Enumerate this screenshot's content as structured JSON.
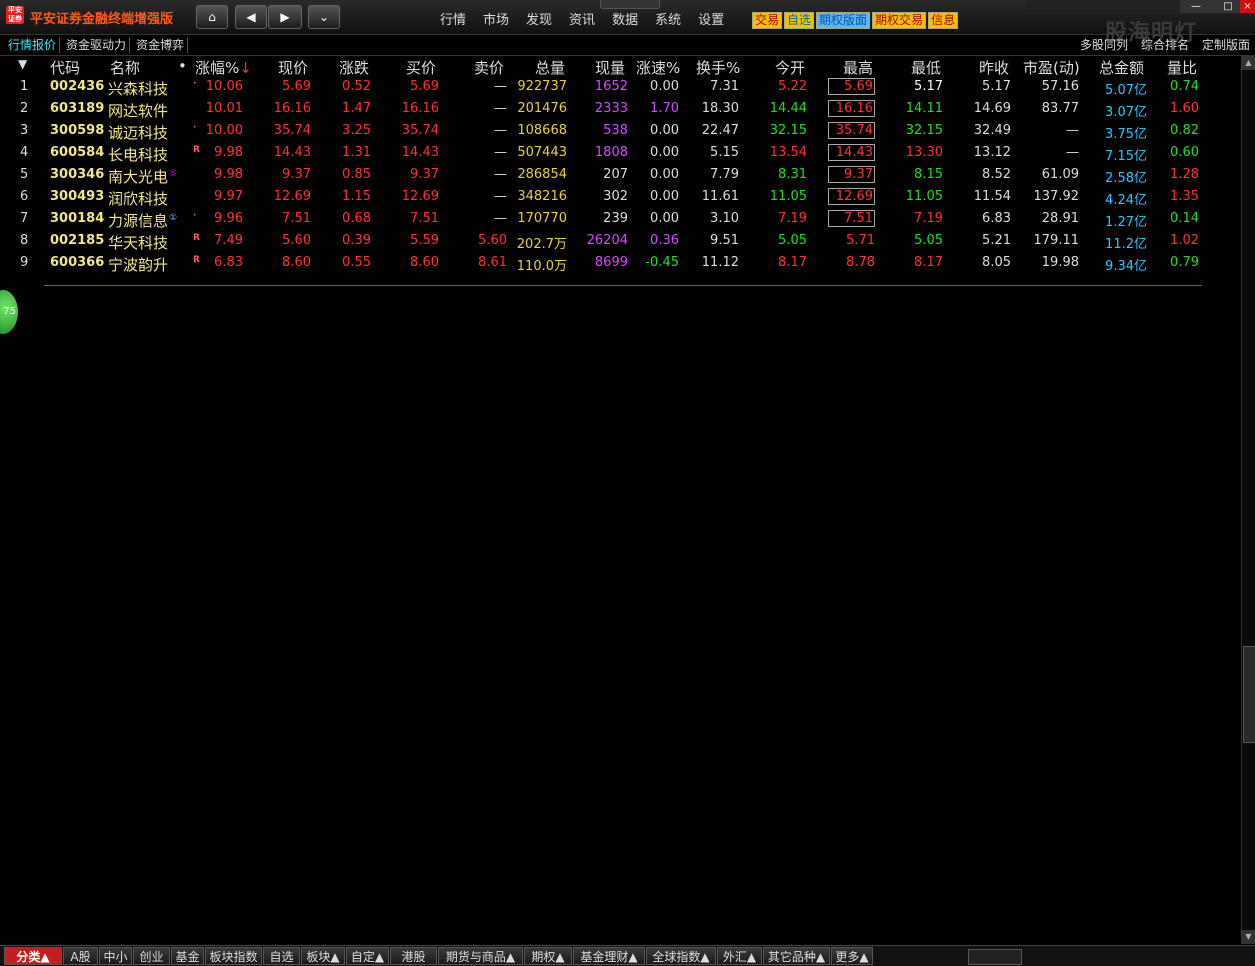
{
  "app": {
    "title": "平安证券金融终端增强版",
    "logo_text": "平安证券",
    "watermark": "股海明灯"
  },
  "nav": {
    "home_icon": "⌂",
    "back_icon": "◀",
    "fwd_icon": "▶",
    "menu_icon": "⌄"
  },
  "menu": [
    "行情",
    "市场",
    "发现",
    "资讯",
    "数据",
    "系统",
    "设置"
  ],
  "quick": {
    "trade": "交易",
    "watch": "自选",
    "option_board": "期权版面",
    "option_trade": "期权交易",
    "info": "信息"
  },
  "window": {
    "min": "—",
    "max": "□",
    "close": "×"
  },
  "tabs": [
    "行情报价",
    "资金驱动力",
    "资金博弈"
  ],
  "right_tabs": [
    "多股同列",
    "综合排名",
    "定制版面"
  ],
  "headers": {
    "idx": "▼",
    "code": "代码",
    "name": "名称",
    "dot": "•",
    "pct": "涨幅%",
    "sort": "↓",
    "price": "现价",
    "chg": "涨跌",
    "bid": "买价",
    "ask": "卖价",
    "vol": "总量",
    "cur": "现量",
    "speed": "涨速%",
    "turn": "换手%",
    "open": "今开",
    "high": "最高",
    "low": "最低",
    "prev": "昨收",
    "pe": "市盈(动)",
    "amt": "总金额",
    "vr": "量比"
  },
  "rows": [
    {
      "idx": "1",
      "code": "002436",
      "name": "兴森科技",
      "badge": "",
      "mark": "·",
      "pct": "10.06",
      "price": "5.69",
      "chg": "0.52",
      "bid": "5.69",
      "ask": "—",
      "vol": "922737",
      "cur": "1652",
      "speed": "0.00",
      "turn": "7.31",
      "open": "5.22",
      "high": "5.69",
      "low": "5.17",
      "prev": "5.17",
      "pe": "57.16",
      "amt": "5.07亿",
      "vr": "0.74"
    },
    {
      "idx": "2",
      "code": "603189",
      "name": "网达软件",
      "badge": "",
      "mark": "",
      "pct": "10.01",
      "price": "16.16",
      "chg": "1.47",
      "bid": "16.16",
      "ask": "—",
      "vol": "201476",
      "cur": "2333",
      "speed": "1.70",
      "turn": "18.30",
      "open": "14.44",
      "high": "16.16",
      "low": "14.11",
      "prev": "14.69",
      "pe": "83.77",
      "amt": "3.07亿",
      "vr": "1.60"
    },
    {
      "idx": "3",
      "code": "300598",
      "name": "诚迈科技",
      "badge": "",
      "mark": "·",
      "pct": "10.00",
      "price": "35.74",
      "chg": "3.25",
      "bid": "35.74",
      "ask": "—",
      "vol": "108668",
      "cur": "538",
      "speed": "0.00",
      "turn": "22.47",
      "open": "32.15",
      "high": "35.74",
      "low": "32.15",
      "prev": "32.49",
      "pe": "—",
      "amt": "3.75亿",
      "vr": "0.82"
    },
    {
      "idx": "4",
      "code": "600584",
      "name": "长电科技",
      "badge": "",
      "mark": "R",
      "pct": "9.98",
      "price": "14.43",
      "chg": "1.31",
      "bid": "14.43",
      "ask": "—",
      "vol": "507443",
      "cur": "1808",
      "speed": "0.00",
      "turn": "5.15",
      "open": "13.54",
      "high": "14.43",
      "low": "13.30",
      "prev": "13.12",
      "pe": "—",
      "amt": "7.15亿",
      "vr": "0.60"
    },
    {
      "idx": "5",
      "code": "300346",
      "name": "南大光电",
      "badge": "⑤",
      "mark": "",
      "pct": "9.98",
      "price": "9.37",
      "chg": "0.85",
      "bid": "9.37",
      "ask": "—",
      "vol": "286854",
      "cur": "207",
      "speed": "0.00",
      "turn": "7.79",
      "open": "8.31",
      "high": "9.37",
      "low": "8.15",
      "prev": "8.52",
      "pe": "61.09",
      "amt": "2.58亿",
      "vr": "1.28"
    },
    {
      "idx": "6",
      "code": "300493",
      "name": "润欣科技",
      "badge": "",
      "mark": "",
      "pct": "9.97",
      "price": "12.69",
      "chg": "1.15",
      "bid": "12.69",
      "ask": "—",
      "vol": "348216",
      "cur": "302",
      "speed": "0.00",
      "turn": "11.61",
      "open": "11.05",
      "high": "12.69",
      "low": "11.05",
      "prev": "11.54",
      "pe": "137.92",
      "amt": "4.24亿",
      "vr": "1.35"
    },
    {
      "idx": "7",
      "code": "300184",
      "name": "力源信息",
      "badge": "①",
      "mark": "·",
      "pct": "9.96",
      "price": "7.51",
      "chg": "0.68",
      "bid": "7.51",
      "ask": "—",
      "vol": "170770",
      "cur": "239",
      "speed": "0.00",
      "turn": "3.10",
      "open": "7.19",
      "high": "7.51",
      "low": "7.19",
      "prev": "6.83",
      "pe": "28.91",
      "amt": "1.27亿",
      "vr": "0.14"
    },
    {
      "idx": "8",
      "code": "002185",
      "name": "华天科技",
      "badge": "",
      "mark": "R",
      "pct": "7.49",
      "price": "5.60",
      "chg": "0.39",
      "bid": "5.59",
      "ask": "5.60",
      "vol": "202.7万",
      "cur": "26204",
      "speed": "0.36",
      "turn": "9.51",
      "open": "5.05",
      "high": "5.71",
      "low": "5.05",
      "prev": "5.21",
      "pe": "179.11",
      "amt": "11.2亿",
      "vr": "1.02"
    },
    {
      "idx": "9",
      "code": "600366",
      "name": "宁波韵升",
      "badge": "",
      "mark": "R",
      "pct": "6.83",
      "price": "8.60",
      "chg": "0.55",
      "bid": "8.60",
      "ask": "8.61",
      "vol": "110.0万",
      "cur": "8699",
      "speed": "-0.45",
      "turn": "11.12",
      "open": "8.17",
      "high": "8.78",
      "low": "8.17",
      "prev": "8.05",
      "pe": "19.98",
      "amt": "9.34亿",
      "vr": "0.79"
    }
  ],
  "float_ball": "75",
  "bottom_tabs": [
    "分类▲",
    "A股",
    "中小",
    "创业",
    "基金",
    "板块指数",
    "自选",
    "板块▲",
    "自定▲",
    "港股",
    "期货与商品▲",
    "期权▲",
    "基金理财▲",
    "全球指数▲",
    "外汇▲",
    "其它品种▲",
    "更多▲"
  ],
  "colors": {
    "up": "#ff3232",
    "down": "#1ee01e",
    "flat": "#dddddd",
    "code": "#f0e68c",
    "volume": "#e8d23a",
    "cur_volume": "#d24bff",
    "amount": "#28c8ff",
    "active_tab": "#c41e1e"
  }
}
